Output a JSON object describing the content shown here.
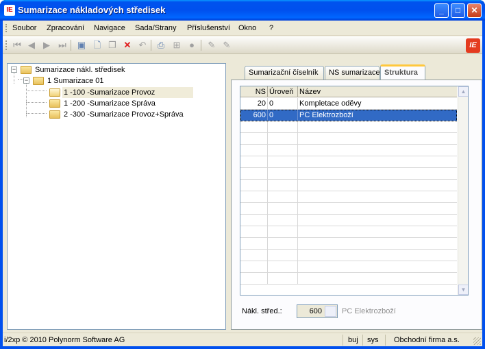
{
  "window": {
    "title": "Sumarizace nákladových středisek",
    "icon_text": "IE",
    "buttons": {
      "minimize": "_",
      "maximize": "□",
      "close": "✕"
    }
  },
  "menu": [
    "Soubor",
    "Zpracování",
    "Navigace",
    "Sada/Strany",
    "Příslušenství",
    "Okno",
    "?"
  ],
  "toolbar": {
    "icons": [
      "first-record-icon",
      "prev-record-icon",
      "next-record-icon",
      "last-record-icon",
      "save-icon",
      "new-icon",
      "copy-icon",
      "delete-icon",
      "undo-icon",
      "print-icon",
      "tree-icon",
      "info-icon",
      "edit-icon",
      "edit-disabled-icon"
    ],
    "logo_text": "IE"
  },
  "tree": {
    "root": "Sumarizace nákl. středisek",
    "child": "1 Sumarizace 01",
    "items": [
      "1 -100 -Sumarizace Provoz",
      "1 -200 -Sumarizace Správa",
      "2 -300 -Sumarizace Provoz+Správa"
    ]
  },
  "tabs": [
    "Sumarizační číselník",
    "NS sumarizace",
    "Struktura"
  ],
  "grid": {
    "headers": [
      "NS",
      "Úroveň",
      "Název"
    ],
    "rows": [
      {
        "ns": "20",
        "level": "0",
        "name": "Kompletace oděvy"
      },
      {
        "ns": "600",
        "level": "0",
        "name": "PC Elektrozboží"
      }
    ],
    "selected_row": 1
  },
  "field": {
    "label": "Nákl. střed.:",
    "value": "600",
    "description": "PC Elektrozboží"
  },
  "status": {
    "copyright": "i/2xp © 2010 Polynorm Software AG",
    "user": "buj",
    "system": "sys",
    "company": "Obchodní firma a.s."
  },
  "colors": {
    "title_blue": "#0053ee",
    "selection": "#316ac5",
    "client": "#ece9d8"
  }
}
